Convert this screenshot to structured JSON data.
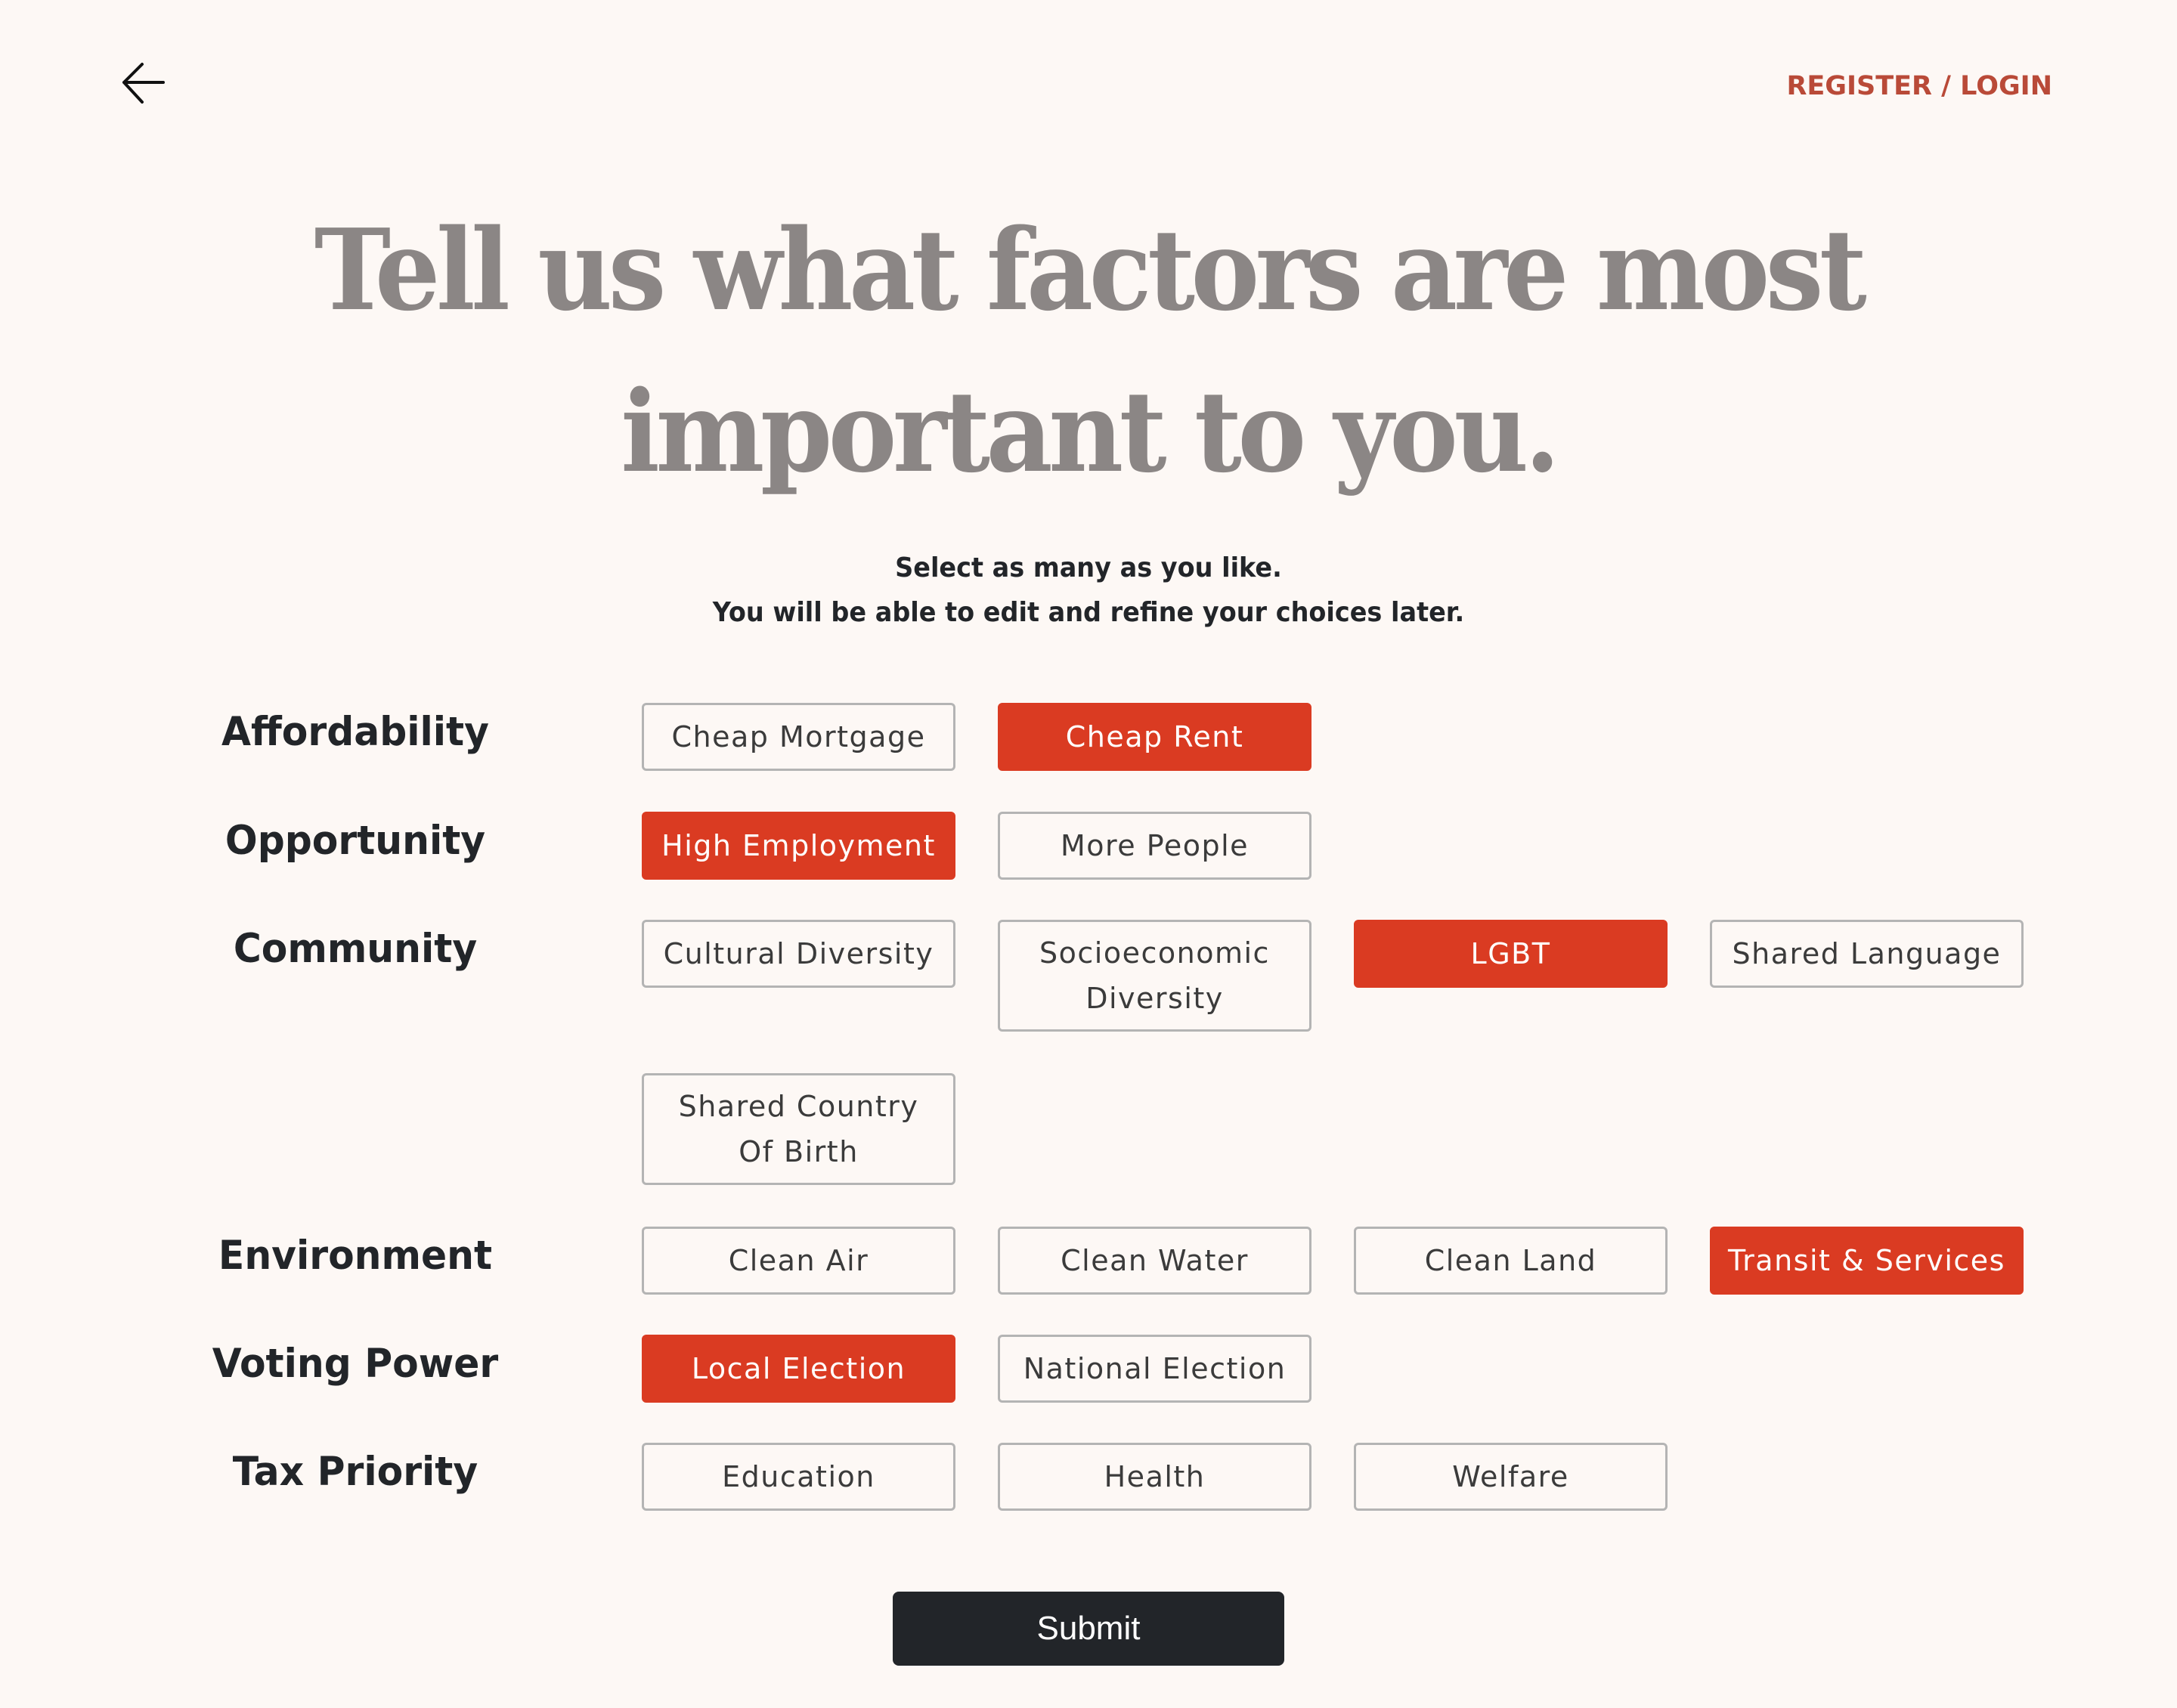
{
  "header": {
    "back_icon": "arrow-left-icon",
    "auth_link": "REGISTER / LOGIN"
  },
  "title": {
    "line1": "Tell us what factors are most",
    "line2": "important to you."
  },
  "subtitle": {
    "line1": "Select as many as you like.",
    "line2": "You will be able to edit and refine your choices later."
  },
  "colors": {
    "accent": "#da3b22",
    "link": "#b94a38",
    "title": "#8b8685",
    "background": "#fdf8f5",
    "submit": "#222529"
  },
  "categories": [
    {
      "label": "Affordability",
      "options": [
        {
          "label": "Cheap Mortgage",
          "selected": false
        },
        {
          "label": "Cheap Rent",
          "selected": true
        }
      ]
    },
    {
      "label": "Opportunity",
      "options": [
        {
          "label": "High Employment",
          "selected": true
        },
        {
          "label": "More People",
          "selected": false
        }
      ]
    },
    {
      "label": "Community",
      "options": [
        {
          "label": "Cultural Diversity",
          "selected": false
        },
        {
          "label": "Socioeconomic Diversity",
          "selected": false
        },
        {
          "label": "LGBT",
          "selected": true
        },
        {
          "label": "Shared Language",
          "selected": false
        },
        {
          "label": "Shared Country Of Birth",
          "selected": false
        }
      ]
    },
    {
      "label": "Environment",
      "options": [
        {
          "label": "Clean Air",
          "selected": false
        },
        {
          "label": "Clean Water",
          "selected": false
        },
        {
          "label": "Clean Land",
          "selected": false
        },
        {
          "label": "Transit & Services",
          "selected": true
        }
      ]
    },
    {
      "label": "Voting Power",
      "options": [
        {
          "label": "Local Election",
          "selected": true
        },
        {
          "label": "National Election",
          "selected": false
        }
      ]
    },
    {
      "label": "Tax Priority",
      "options": [
        {
          "label": "Education",
          "selected": false
        },
        {
          "label": "Health",
          "selected": false
        },
        {
          "label": "Welfare",
          "selected": false
        }
      ]
    }
  ],
  "submit_label": "Submit"
}
